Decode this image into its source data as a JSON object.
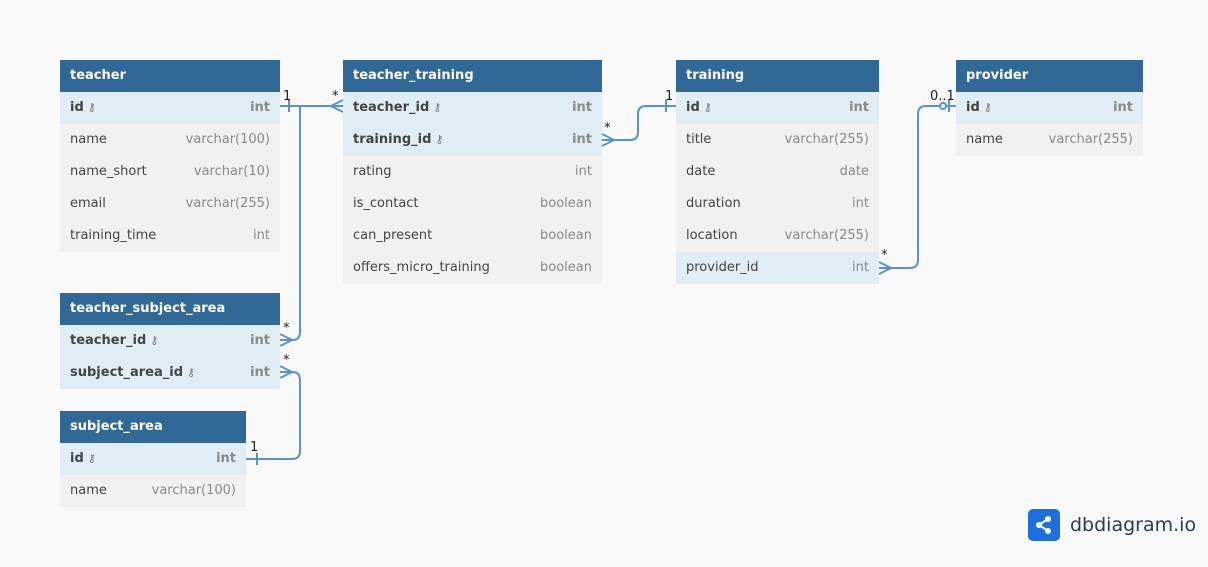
{
  "tables": {
    "teacher": {
      "name": "teacher",
      "fields": [
        {
          "name": "id",
          "type": "int",
          "pk": true
        },
        {
          "name": "name",
          "type": "varchar(100)"
        },
        {
          "name": "name_short",
          "type": "varchar(10)"
        },
        {
          "name": "email",
          "type": "varchar(255)"
        },
        {
          "name": "training_time",
          "type": "int"
        }
      ]
    },
    "teacher_training": {
      "name": "teacher_training",
      "fields": [
        {
          "name": "teacher_id",
          "type": "int",
          "pk": true
        },
        {
          "name": "training_id",
          "type": "int",
          "pk": true
        },
        {
          "name": "rating",
          "type": "int"
        },
        {
          "name": "is_contact",
          "type": "boolean"
        },
        {
          "name": "can_present",
          "type": "boolean"
        },
        {
          "name": "offers_micro_training",
          "type": "boolean"
        }
      ]
    },
    "training": {
      "name": "training",
      "fields": [
        {
          "name": "id",
          "type": "int",
          "pk": true
        },
        {
          "name": "title",
          "type": "varchar(255)"
        },
        {
          "name": "date",
          "type": "date"
        },
        {
          "name": "duration",
          "type": "int"
        },
        {
          "name": "location",
          "type": "varchar(255)"
        },
        {
          "name": "provider_id",
          "type": "int",
          "highlight": true
        }
      ]
    },
    "provider": {
      "name": "provider",
      "fields": [
        {
          "name": "id",
          "type": "int",
          "pk": true
        },
        {
          "name": "name",
          "type": "varchar(255)"
        }
      ]
    },
    "teacher_subject_area": {
      "name": "teacher_subject_area",
      "fields": [
        {
          "name": "teacher_id",
          "type": "int",
          "pk": true
        },
        {
          "name": "subject_area_id",
          "type": "int",
          "pk": true
        }
      ]
    },
    "subject_area": {
      "name": "subject_area",
      "fields": [
        {
          "name": "id",
          "type": "int",
          "pk": true
        },
        {
          "name": "name",
          "type": "varchar(100)"
        }
      ]
    }
  },
  "relation_labels": {
    "teacher_one": "1",
    "tt_teacher_many": "*",
    "tt_training_many": "*",
    "training_one": "1",
    "provider_zero_one": "0..1",
    "training_provider_many": "*",
    "tsa_teacher_many": "*",
    "tsa_subject_many": "*",
    "subject_area_one": "1"
  },
  "brand": {
    "name": "dbdiagram.io"
  },
  "colors": {
    "header": "#316896",
    "pk_row": "#e1edf5",
    "row": "#f1f1f1",
    "link": "#5b93c7"
  }
}
